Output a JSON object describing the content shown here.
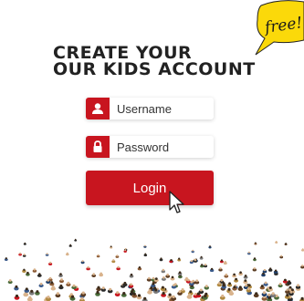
{
  "badge": {
    "text": "free!"
  },
  "title": {
    "line1": "CREATE YOUR",
    "line2": "OUR KIDS ACCOUNT"
  },
  "username": {
    "placeholder": "Username",
    "value": ""
  },
  "password": {
    "placeholder": "Password",
    "value": ""
  },
  "login": {
    "label": "Login"
  },
  "colors": {
    "accent": "#c8151f",
    "badge": "#fbd90a",
    "text": "#222222"
  },
  "icons": {
    "username": "user-icon",
    "password": "lock-icon",
    "cursor": "mouse-pointer-icon"
  }
}
